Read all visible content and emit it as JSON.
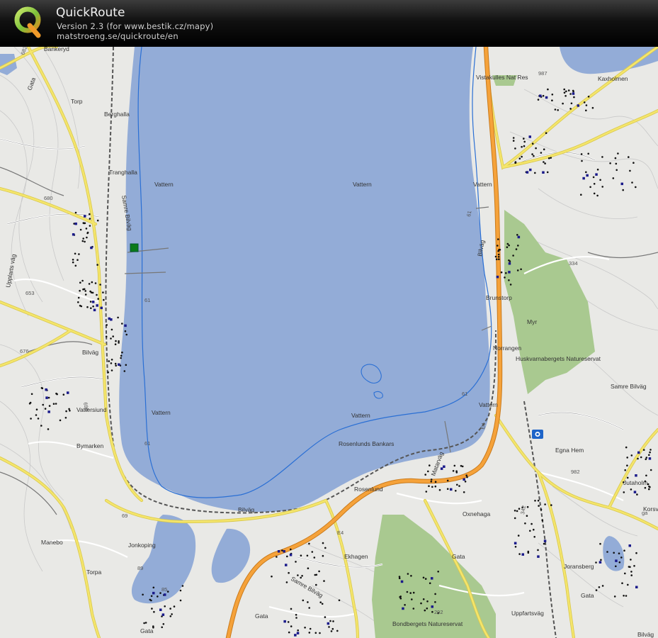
{
  "header": {
    "app_name": "QuickRoute",
    "version_line": "Version 2.3  (for www.bestik.cz/mapy)",
    "url_line": "matstroeng.se/quickroute/en",
    "logo_letter": "Q"
  },
  "map": {
    "water_labels": [
      "Vattern",
      "Vattern",
      "Vattern",
      "Vattern",
      "Vattern",
      "Vattern"
    ],
    "place_labels": [
      "Bankeryd",
      "Torp",
      "Berghalla",
      "Tranghalla",
      "Samre Bilväg",
      "Vattersiund",
      "Bymarken",
      "Jonkoping",
      "Manebo",
      "Torpa",
      "Gata",
      "Vistakulles Nat Res",
      "Kaxholmen",
      "Brunstorp",
      "Myr",
      "Norrangen",
      "Huskvarnabergets Natureservat",
      "Samre Bilväg",
      "Rosenlunds Bankars",
      "Rosenlund",
      "Egna Hem",
      "Oxnehaga",
      "Ekhagen",
      "Gata",
      "Bondbergets Natureservat",
      "Joransberg",
      "Gata",
      "Uppfartsväg",
      "Jutaholm",
      "Korsvi",
      "Bilväg",
      "Upplarts väg",
      "Bilväg",
      "Gata",
      "Samre Bilväg",
      "Bilväg",
      "Gata",
      "Bilväg",
      "Matarväg"
    ],
    "road_numbers": [
      "682",
      "680",
      "653",
      "676",
      "695",
      "987",
      "69",
      "61",
      "61",
      "61",
      "61",
      "E4",
      "E4",
      "334",
      "292",
      "85",
      "89",
      "982",
      "342",
      "ga"
    ],
    "accent": {
      "water": "#93acd7",
      "forest": "#a9c990",
      "road_major": "#f5a23a",
      "road_minor": "#f2e36a",
      "shore_line": "#2a6fd4",
      "marker": "#0a7a1a"
    },
    "icons": [
      "start-marker-icon",
      "camera-icon"
    ]
  }
}
